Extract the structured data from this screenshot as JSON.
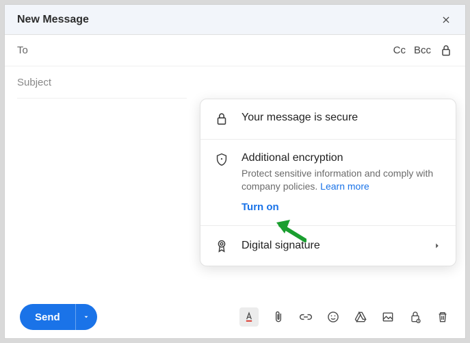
{
  "window": {
    "title": "New Message"
  },
  "fields": {
    "to_label": "To",
    "cc_label": "Cc",
    "bcc_label": "Bcc",
    "subject_placeholder": "Subject"
  },
  "panel": {
    "secure": {
      "title": "Your message is secure"
    },
    "encryption": {
      "title": "Additional encryption",
      "desc": "Protect sensitive information and comply with company policies. ",
      "learn_more": "Learn more",
      "action": "Turn on"
    },
    "signature": {
      "title": "Digital signature"
    }
  },
  "toolbar": {
    "send_label": "Send"
  }
}
